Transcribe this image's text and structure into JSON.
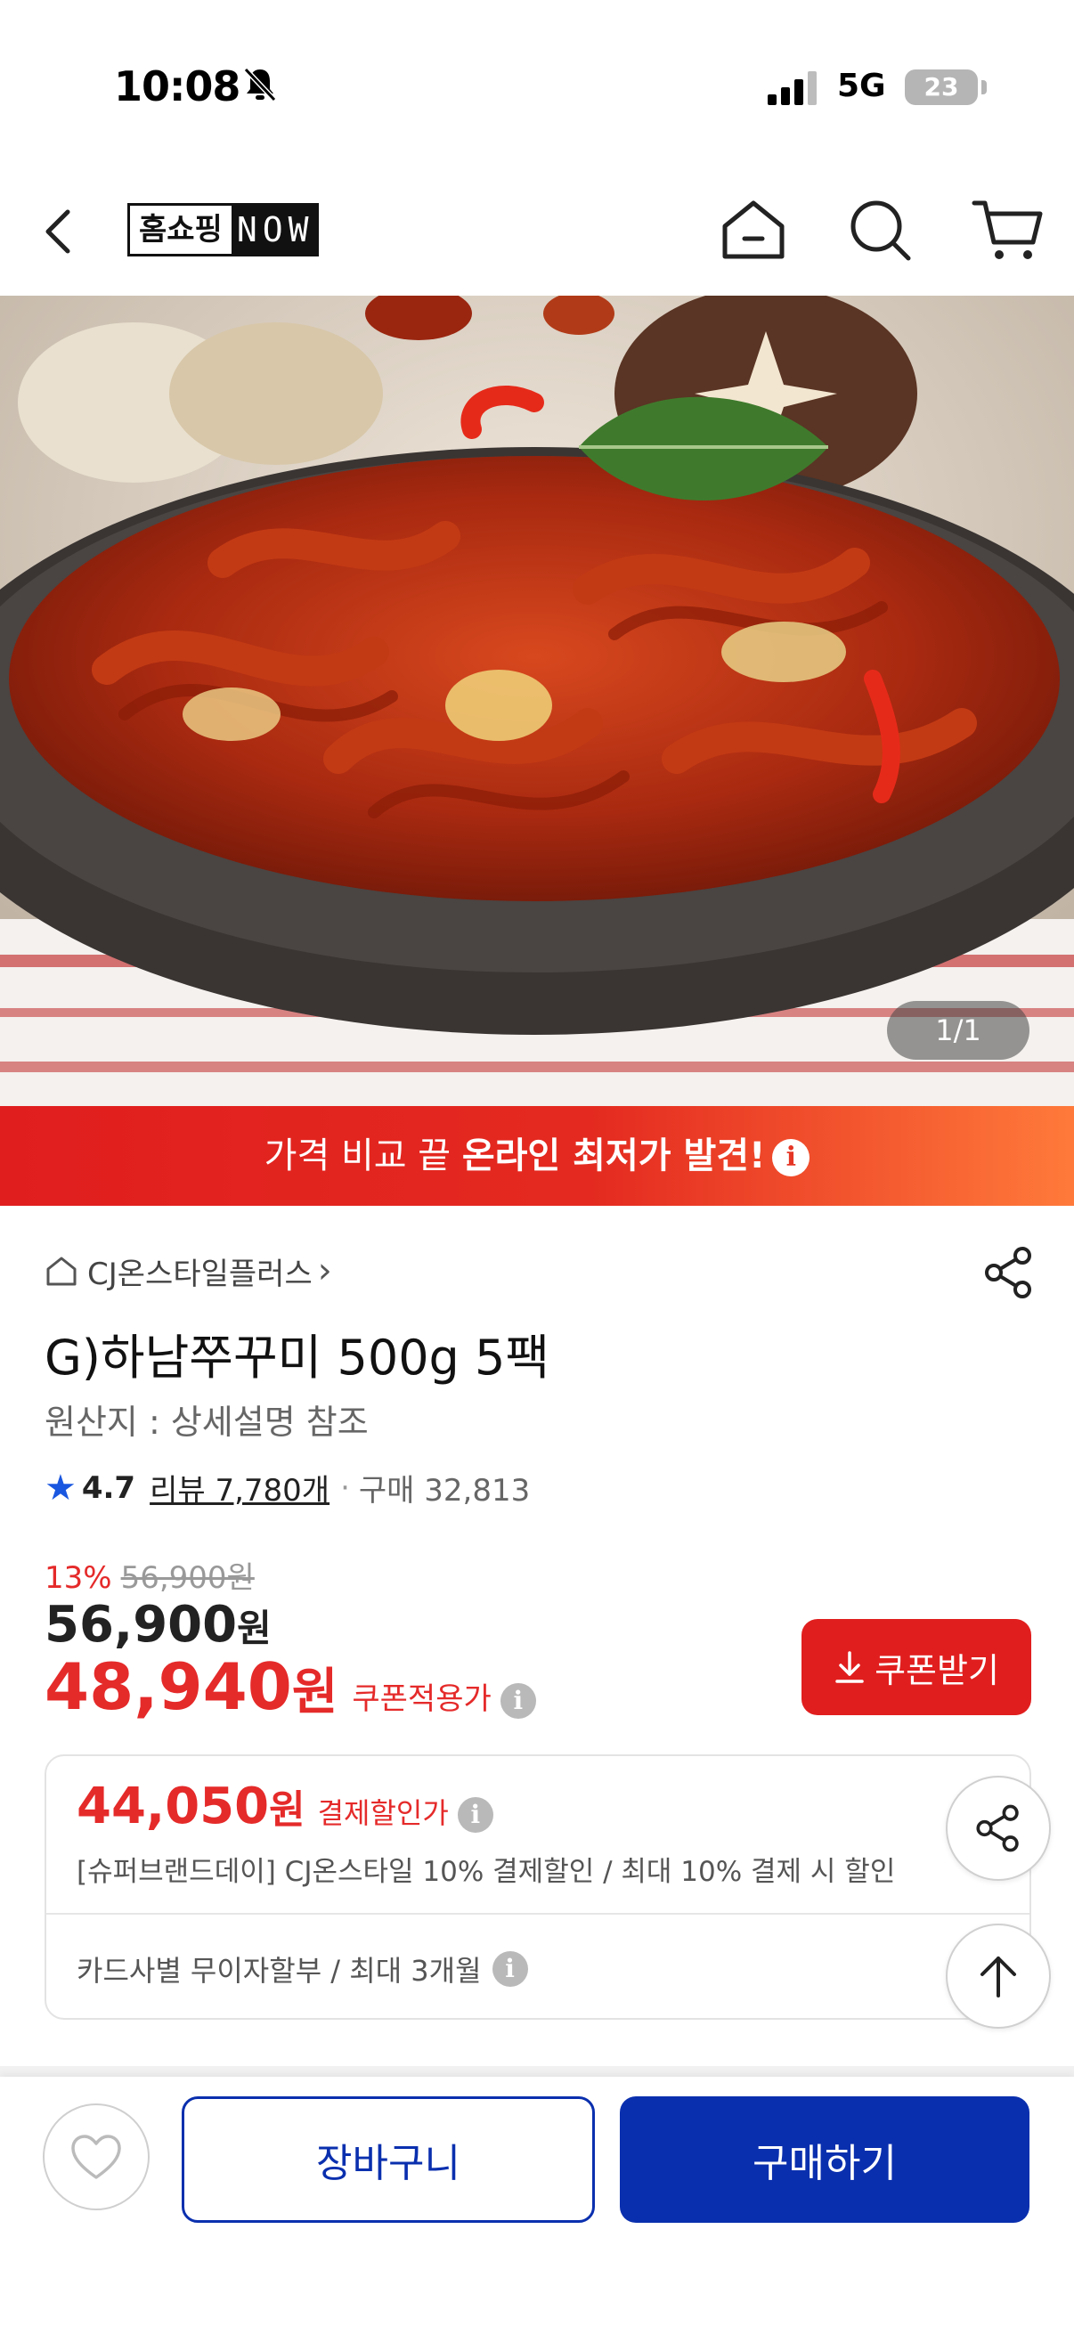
{
  "status_bar": {
    "time": "10:08",
    "network": "5G",
    "battery": "23"
  },
  "header": {
    "logo_left": "홈쇼핑",
    "logo_right": "NOW",
    "icons": [
      "back-icon",
      "home-icon",
      "search-icon",
      "cart-icon"
    ]
  },
  "gallery": {
    "counter": "1/1"
  },
  "promo": {
    "text_prefix": "가격 비교 끝 ",
    "text_bold": "온라인 최저가 발견!",
    "info_glyph": "i"
  },
  "product": {
    "store": "CJ온스타일플러스",
    "store_chevron": "›",
    "title": "G)하남쭈꾸미 500g 5팩",
    "origin": "원산지 : 상세설명 참조",
    "rating": "4.7",
    "reviews": "리뷰 7,780개",
    "bullet": "·",
    "purchases": "구매 32,813"
  },
  "pricing": {
    "discount_rate": "13%",
    "original_price": "56,900원",
    "price": "56,900",
    "price_unit": "원",
    "coupon_price": "48,940",
    "coupon_unit": "원",
    "coupon_label": "쿠폰적용가",
    "coupon_button": "쿠폰받기",
    "info_glyph": "i"
  },
  "payment": {
    "price": "44,050",
    "unit": "원",
    "label": "결제할인가",
    "description": "[슈퍼브랜드데이] CJ온스타일 10% 결제할인 / 최대 10% 결제 시 할인",
    "installment": "카드사별 무이자할부 / 최대 3개월"
  },
  "actions": {
    "cart": "장바구니",
    "buy": "구매하기"
  },
  "colors": {
    "accent_red": "#e11e1e",
    "brand_blue": "#0a2fae",
    "rating_star": "#1a57e0"
  }
}
